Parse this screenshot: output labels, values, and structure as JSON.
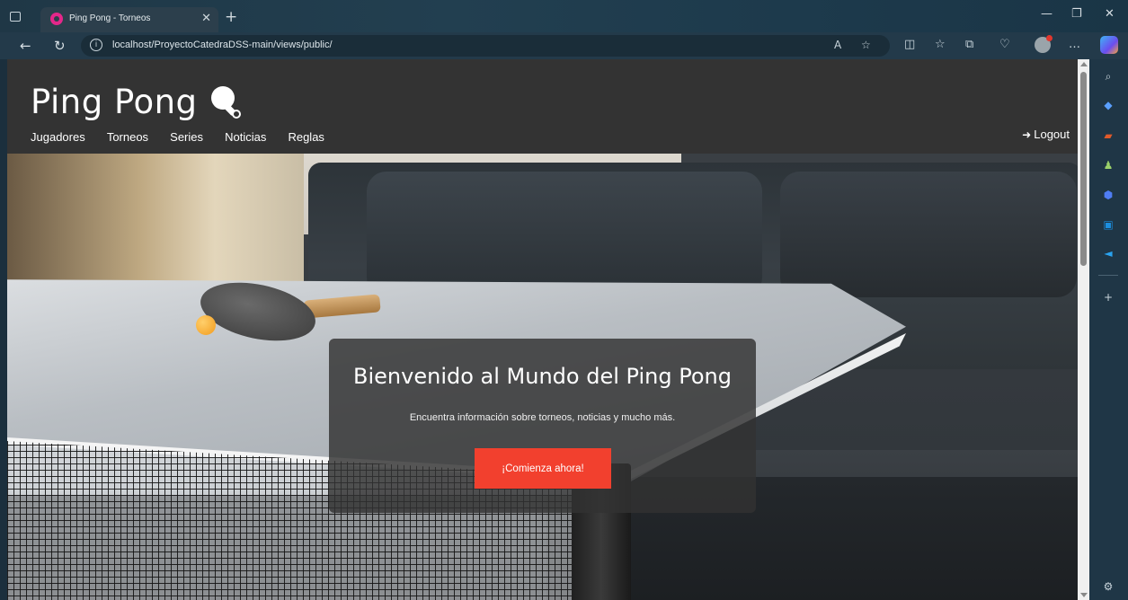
{
  "browser": {
    "tab_title": "Ping Pong - Torneos",
    "url": "localhost/ProyectoCatedraDSS-main/views/public/",
    "icons": {
      "back": "back-arrow-icon",
      "refresh": "refresh-icon",
      "info": "info-icon",
      "read_aloud": "read-aloud-icon",
      "favorite": "star-icon",
      "split": "split-screen-icon",
      "favorites": "favorites-list-icon",
      "collections": "collections-icon",
      "heart": "browser-essentials-icon",
      "more": "more-icon"
    }
  },
  "site": {
    "brand": "Ping Pong",
    "nav": [
      "Jugadores",
      "Torneos",
      "Series",
      "Noticias",
      "Reglas"
    ],
    "logout": "Logout"
  },
  "hero": {
    "title": "Bienvenido al Mundo del Ping Pong",
    "subtitle": "Encuentra información sobre torneos, noticias y mucho más.",
    "cta": "¡Comienza ahora!"
  },
  "colors": {
    "header_bg": "#333333",
    "cta": "#f2402e",
    "chrome": "#233a4a"
  }
}
